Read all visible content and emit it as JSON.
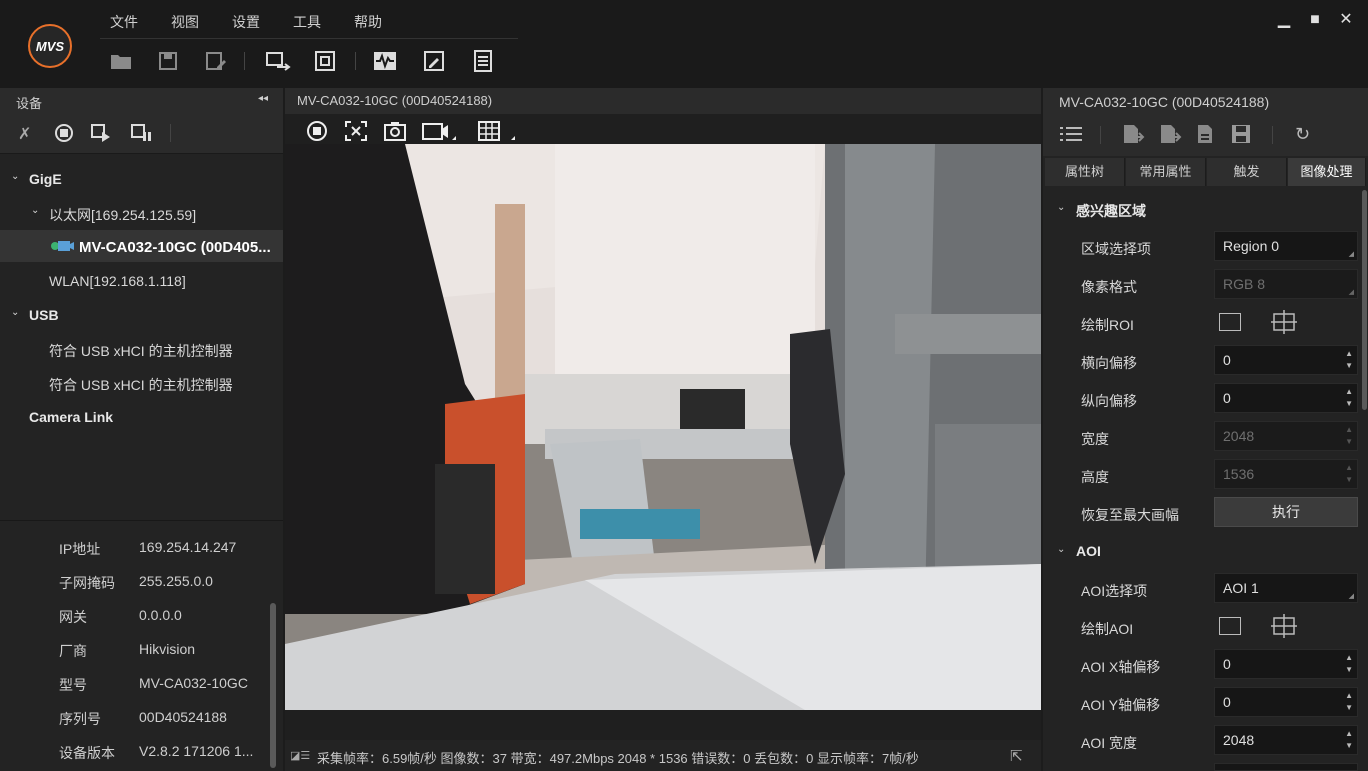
{
  "menu": [
    "文件",
    "视图",
    "设置",
    "工具",
    "帮助"
  ],
  "logo_text": "MVS",
  "left": {
    "header": "设备",
    "tree": {
      "gige": "GigE",
      "ethernet": "以太网[169.254.125.59]",
      "camera": "MV-CA032-10GC (00D405...",
      "wlan": "WLAN[192.168.1.118]",
      "usb": "USB",
      "usb1": "符合 USB xHCI 的主机控制器",
      "usb2": "符合 USB xHCI 的主机控制器",
      "cameralink": "Camera Link"
    },
    "info": [
      {
        "k": "IP地址",
        "v": "169.254.14.247"
      },
      {
        "k": "子网掩码",
        "v": "255.255.0.0"
      },
      {
        "k": "网关",
        "v": "0.0.0.0"
      },
      {
        "k": "厂商",
        "v": "Hikvision"
      },
      {
        "k": "型号",
        "v": "MV-CA032-10GC"
      },
      {
        "k": "序列号",
        "v": "00D40524188"
      },
      {
        "k": "设备版本",
        "v": "V2.8.2 171206 1..."
      }
    ]
  },
  "center": {
    "title": "MV-CA032-10GC (00D40524188)",
    "status": "采集帧率：6.59帧/秒 图像数：37 带宽：497.2Mbps 2048 * 1536 错误数：0 丢包数：0 显示帧率：7帧/秒"
  },
  "right": {
    "title": "MV-CA032-10GC (00D40524188)",
    "tabs": [
      "属性树",
      "常用属性",
      "触发",
      "图像处理"
    ],
    "sec1": "感兴趣区域",
    "sec2": "AOI",
    "props": {
      "region_sel": {
        "label": "区域选择项",
        "value": "Region 0"
      },
      "pixfmt": {
        "label": "像素格式",
        "value": "RGB 8"
      },
      "draw_roi": {
        "label": "绘制ROI"
      },
      "offx": {
        "label": "横向偏移",
        "value": "0"
      },
      "offy": {
        "label": "纵向偏移",
        "value": "0"
      },
      "width": {
        "label": "宽度",
        "value": "2048"
      },
      "height": {
        "label": "高度",
        "value": "1536"
      },
      "restore": {
        "label": "恢复至最大画幅",
        "button": "执行"
      },
      "aoi_sel": {
        "label": "AOI选择项",
        "value": "AOI 1"
      },
      "draw_aoi": {
        "label": "绘制AOI"
      },
      "aoi_x": {
        "label": "AOI X轴偏移",
        "value": "0"
      },
      "aoi_y": {
        "label": "AOI Y轴偏移",
        "value": "0"
      },
      "aoi_w": {
        "label": "AOI 宽度",
        "value": "2048"
      }
    }
  },
  "colors": {
    "accent": "#e8702a",
    "bg": "#1c1c1c"
  }
}
